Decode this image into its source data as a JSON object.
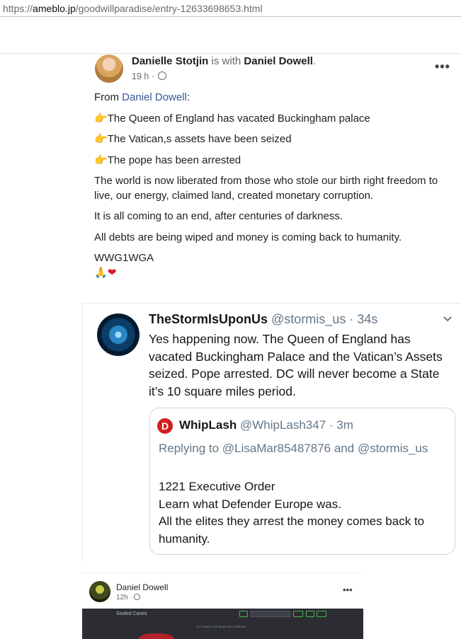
{
  "browser": {
    "url_prefix": "https://",
    "url_domain": "ameblo.jp",
    "url_path": "/goodwillparadise/entry-12633698653.html"
  },
  "post": {
    "author": "Danielle Stotjin",
    "with_text": "is with",
    "tagged": "Daniel Dowell",
    "period": ".",
    "time": "19 h ·",
    "more": "•••",
    "from_label": "From",
    "from_name": "Daniel Dowell",
    "from_colon": ":",
    "bullet_icon": "pointing-hand",
    "lines": [
      "The Queen of England has vacated Buckingham palace",
      "The Vatican,s assets have been seized",
      "The pope has been arrested"
    ],
    "paragraph1": "The world is now liberated from those who stole our birth right freedom to live, our energy, claimed land, created monetary corruption.",
    "paragraph2": "It is all coming to an end, after centuries of darkness.",
    "paragraph3": "All debts are being wiped and money is coming back to humanity.",
    "tag": "WWG1WGA",
    "emoji_icons": [
      "praying-hands",
      "red-heart"
    ]
  },
  "tweet": {
    "name": "TheStormIsUponUs",
    "handle": "@stormis_us",
    "dot": "·",
    "time": "34s",
    "text": "Yes happening now. The Queen of England has vacated Buckingham Palace and the Vatican’s Assets seized. Pope arrested. DC will never become a State it’s 10 square miles period.",
    "quote": {
      "avatar_letter": "D",
      "name": "WhipLash",
      "handle": "@WhipLash347",
      "time": "· 3m",
      "replying": "Replying to @LisaMar85487876 and @stormis_us",
      "line1": "1221 Executive Order",
      "line2": "Learn what Defender Europe was.",
      "line3": "All the elites they arrest the money comes back to humanity."
    }
  },
  "post2": {
    "author": "Daniel Dowell",
    "time": "12h ·",
    "more": "•••",
    "image_label": "Sealed Cases",
    "image_sub": "NOT MADE FOR SMALLER SCREENS"
  },
  "colors": {
    "facebook_link": "#385898",
    "twitter_muted": "#657786",
    "heart": "#d81b2c"
  }
}
